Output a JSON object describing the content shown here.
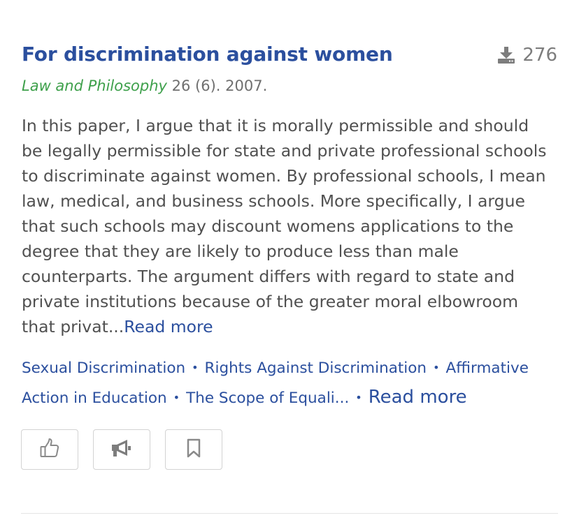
{
  "entry": {
    "title": "For discrimination against women",
    "download_count": "276",
    "journal": "Law and Philosophy",
    "citation": " 26 (6). 2007.",
    "abstract_lines": [
      "In this paper, I argue that it is morally permissible and should",
      "be legally permissible for state and private professional schools",
      "to discriminate against women. By professional schools, I mean",
      "law, medical, and business schools. More specifically, I argue",
      "that such schools may discount womens applications to the",
      "degree that they are likely to produce less than male",
      "counterparts. The argument differs with regard to state and",
      "private institutions because of the greater moral elbowroom",
      "that privat..."
    ],
    "abstract_read_more": "Read more",
    "tags": [
      "Sexual Discrimination",
      "Rights Against Discrimination",
      "Affirmative",
      "Action in Education",
      "The Scope of Equali..."
    ],
    "tag_separator": "•",
    "tags_read_more": "Read more"
  },
  "actions": {
    "like_icon": "thumbs-up-icon",
    "share_icon": "megaphone-icon",
    "bookmark_icon": "bookmark-icon"
  },
  "colors": {
    "title": "#2b4f9e",
    "journal": "#3ea04b",
    "body_text": "#505050",
    "muted": "#7d7d7d",
    "border": "#d3d3d3"
  }
}
